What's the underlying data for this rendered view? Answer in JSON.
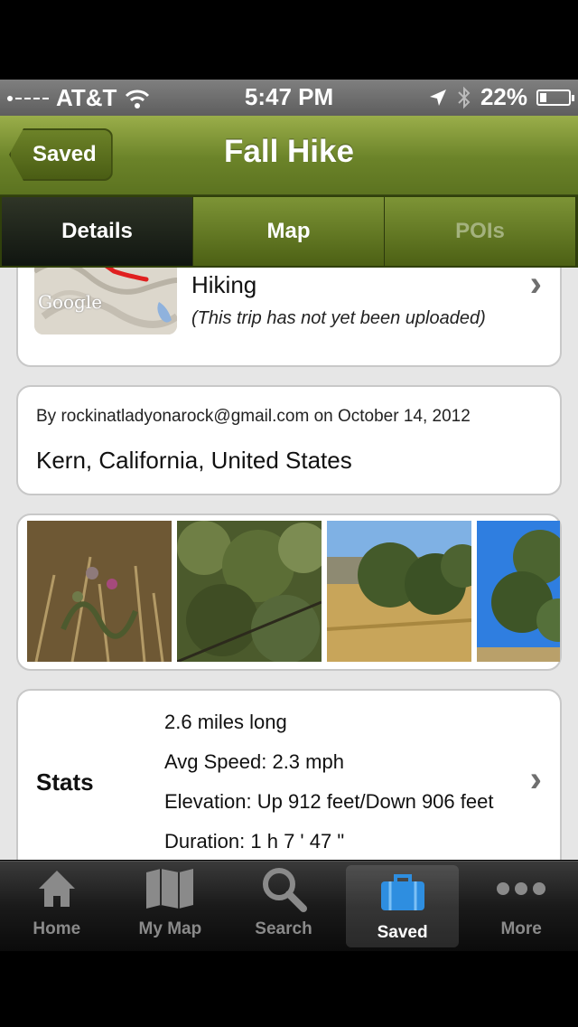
{
  "status": {
    "carrier": "AT&T",
    "time": "5:47 PM",
    "battery": "22%",
    "battery_level": 0.22
  },
  "nav": {
    "back_label": "Saved",
    "title": "Fall Hike"
  },
  "tabs": [
    {
      "label": "Details",
      "state": "selected"
    },
    {
      "label": "Map",
      "state": "normal"
    },
    {
      "label": "POIs",
      "state": "disabled"
    }
  ],
  "route": {
    "activity": "Hiking",
    "upload_status": "(This trip has not yet been uploaded)",
    "map_brand": "Google"
  },
  "info": {
    "author_line": "By rockinatladyonarock@gmail.com on October 14, 2012",
    "location": "Kern, California, United States"
  },
  "photos": [
    {
      "name": "thistle-photo"
    },
    {
      "name": "shrub-photo"
    },
    {
      "name": "oak-hillside-photo"
    },
    {
      "name": "tree-sky-photo"
    }
  ],
  "stats": {
    "label": "Stats",
    "distance": "2.6 miles long",
    "avg_speed": "Avg Speed: 2.3 mph",
    "elevation": "Elevation: Up 912 feet/Down 906 feet",
    "duration": "Duration: 1 h 7 ' 47 \""
  },
  "tab_bar": [
    {
      "label": "Home",
      "icon": "home-icon"
    },
    {
      "label": "My Map",
      "icon": "folded-map-icon"
    },
    {
      "label": "Search",
      "icon": "search-icon"
    },
    {
      "label": "Saved",
      "icon": "briefcase-icon",
      "selected": true
    },
    {
      "label": "More",
      "icon": "more-dots-icon"
    }
  ],
  "colors": {
    "nav_green": "#6b8329",
    "accent_blue": "#2e8ee0",
    "route_red": "#e02020"
  }
}
